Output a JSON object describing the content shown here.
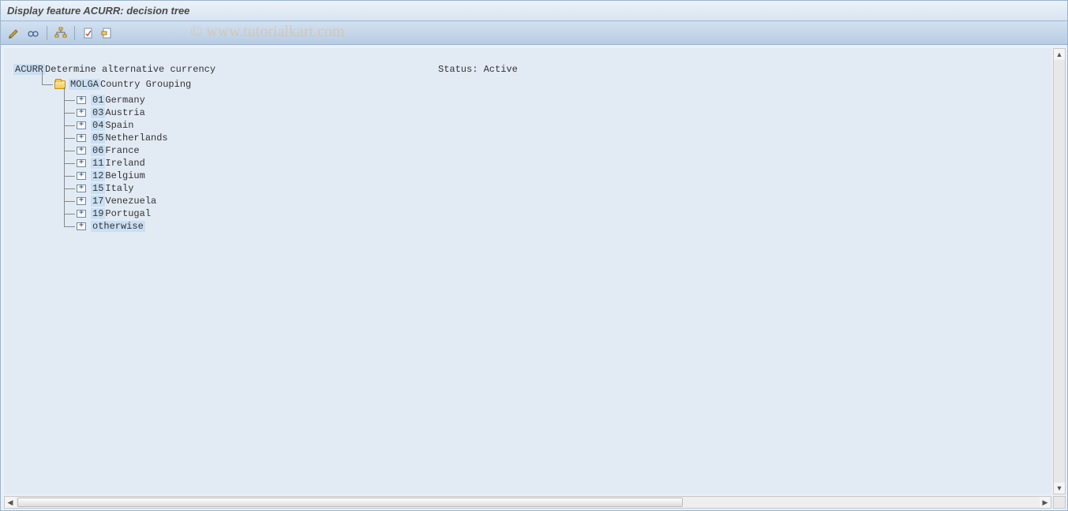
{
  "title": "Display feature ACURR: decision tree",
  "watermark": "© www.tutorialkart.com",
  "toolbar": {
    "icons": [
      "toggle-icon",
      "glasses-icon",
      "hierarchy-icon",
      "doc1-icon",
      "doc2-icon"
    ]
  },
  "tree": {
    "root_code": "ACURR",
    "root_desc": " Determine alternative currency",
    "status_label": "Status: ",
    "status_value": "Active",
    "group_code": "MOLGA",
    "group_desc": " Country Grouping",
    "items": [
      {
        "code": "01",
        "label": " Germany"
      },
      {
        "code": "03",
        "label": " Austria"
      },
      {
        "code": "04",
        "label": " Spain"
      },
      {
        "code": "05",
        "label": " Netherlands"
      },
      {
        "code": "06",
        "label": " France"
      },
      {
        "code": "11",
        "label": " Ireland"
      },
      {
        "code": "12",
        "label": " Belgium"
      },
      {
        "code": "15",
        "label": " Italy"
      },
      {
        "code": "17",
        "label": " Venezuela"
      },
      {
        "code": "19",
        "label": " Portugal"
      },
      {
        "code": "otherwise",
        "label": ""
      }
    ]
  }
}
